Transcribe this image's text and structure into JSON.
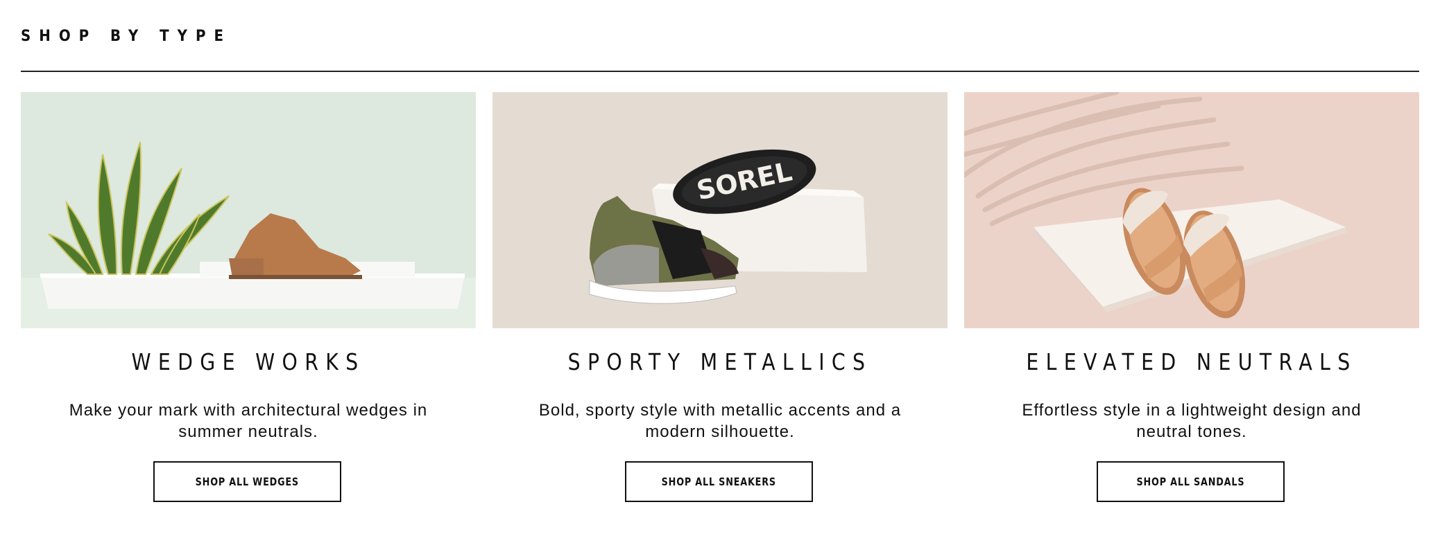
{
  "section": {
    "title": "SHOP BY TYPE"
  },
  "cards": [
    {
      "title": "WEDGE WORKS",
      "description": "Make your mark with architectural wedges in summer neutrals.",
      "button": "SHOP ALL WEDGES",
      "image": "wedge-sandal-with-plant-image",
      "bg_color": "#dde8de"
    },
    {
      "title": "SPORTY METALLICS",
      "description": "Bold, sporty style with metallic accents and a modern silhouette.",
      "button": "SHOP ALL SNEAKERS",
      "image": "metallic-sneakers-image",
      "bg_color": "#e4dcd3",
      "logo_text": "SOREL"
    },
    {
      "title": "ELEVATED NEUTRALS",
      "description": "Effortless style in a lightweight design and neutral tones.",
      "button": "SHOP ALL SANDALS",
      "image": "neutral-sandals-image",
      "bg_color": "#ecd3c9"
    }
  ]
}
